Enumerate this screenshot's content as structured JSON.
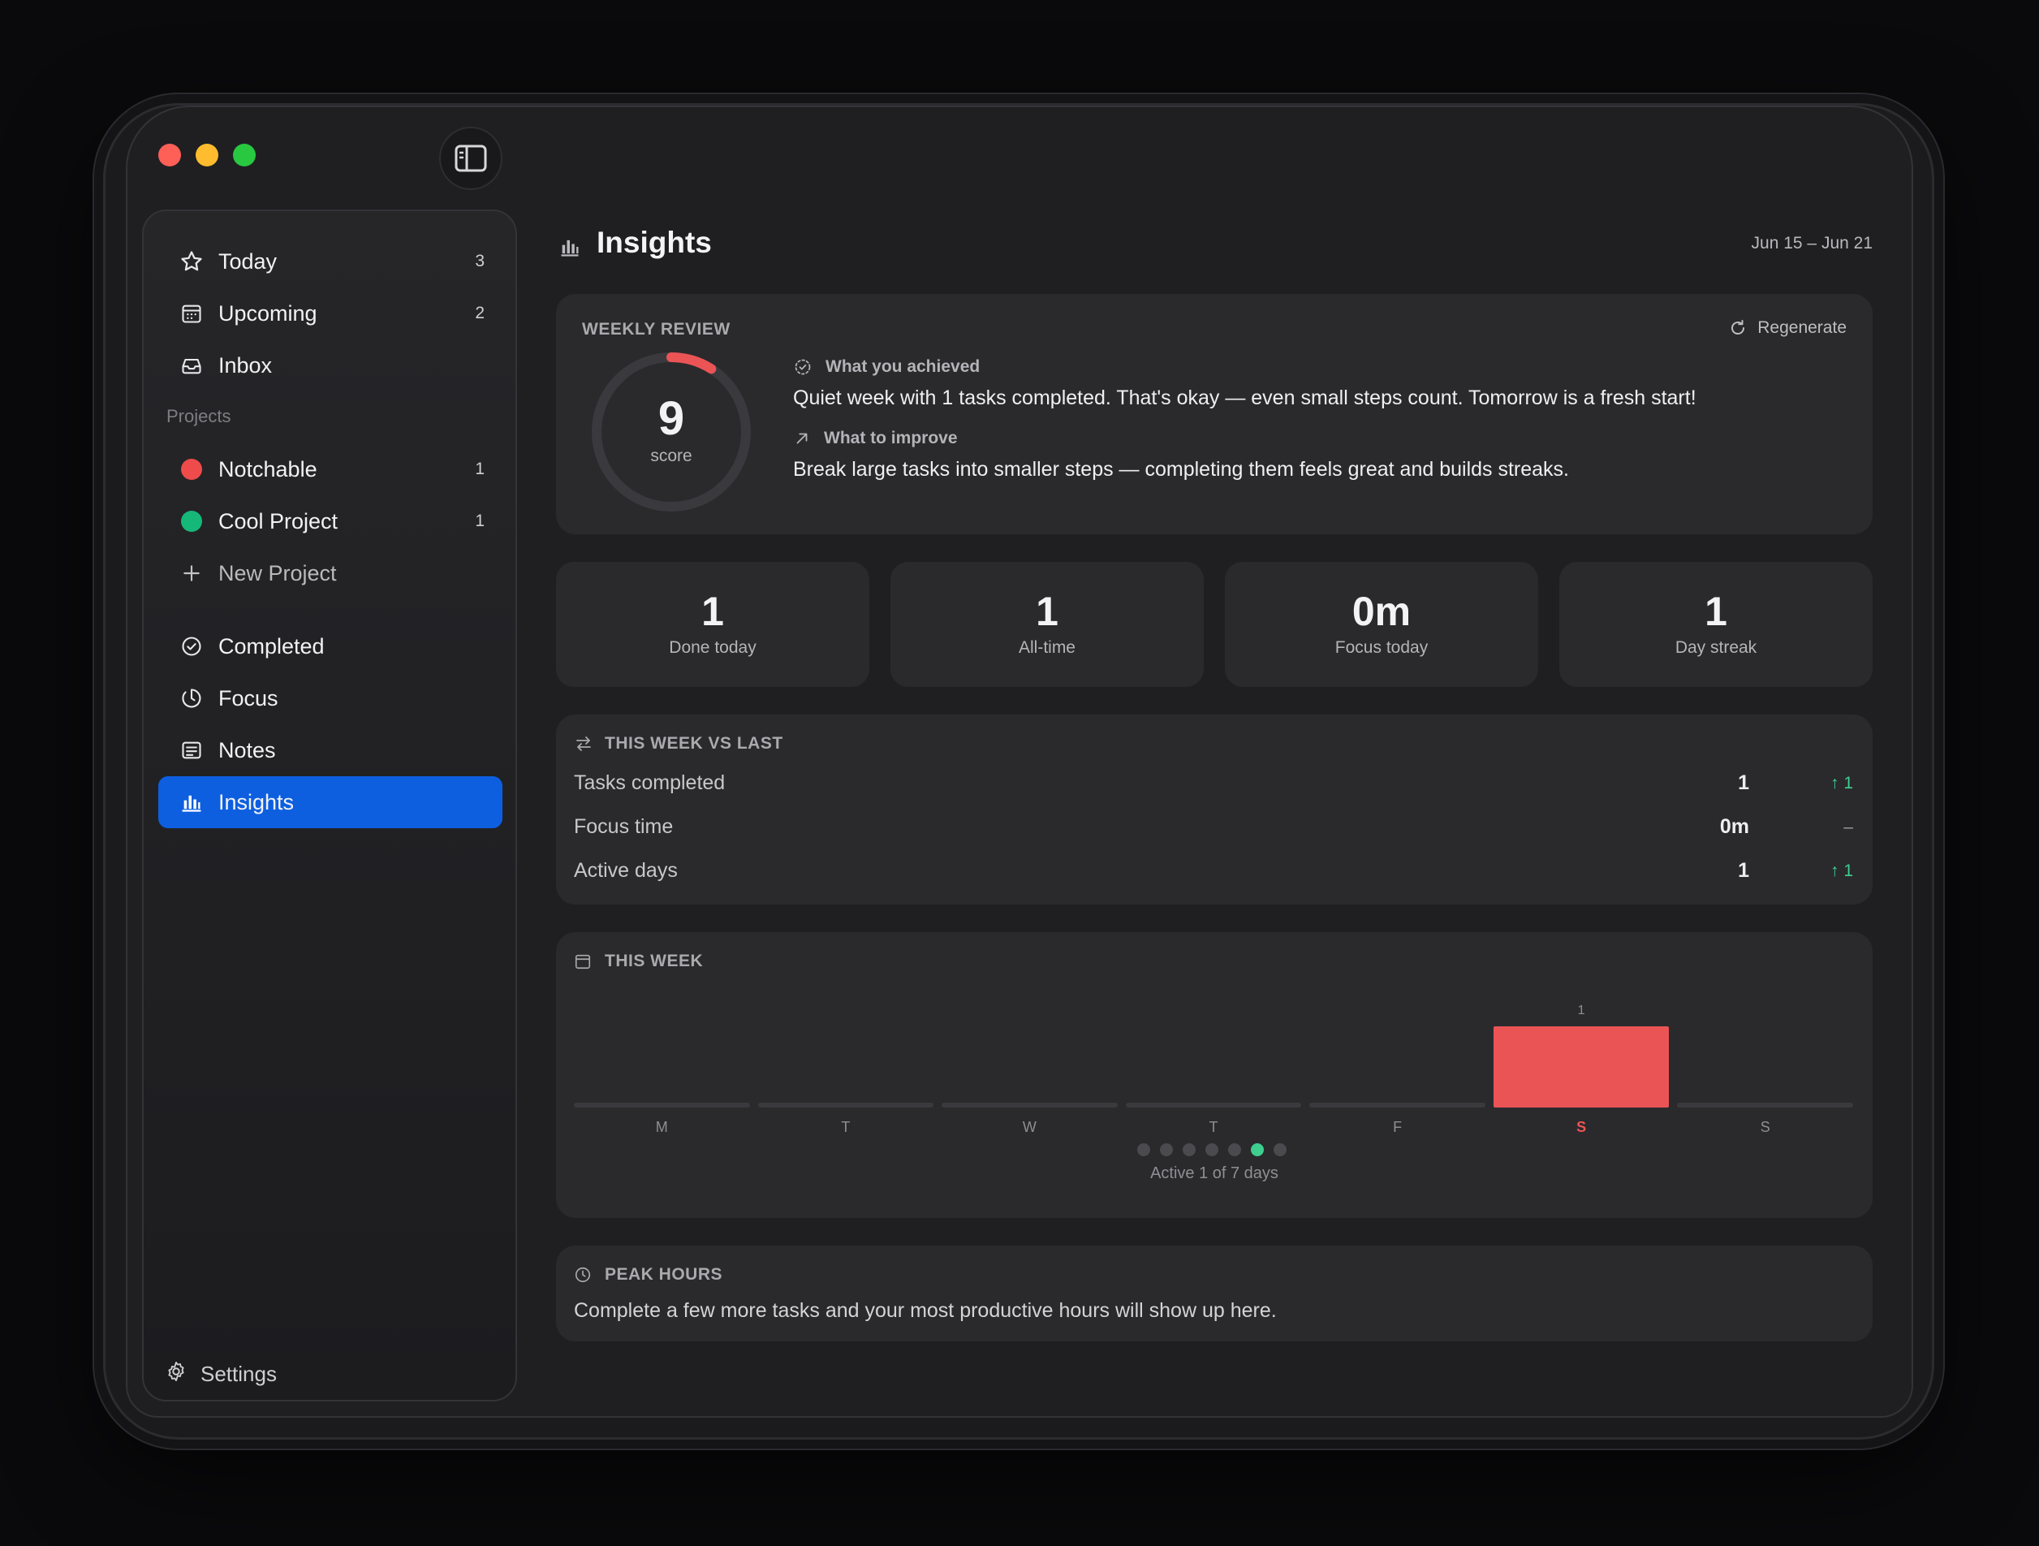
{
  "colors": {
    "accent": "#0d5fe0",
    "bar_highlight": "#ea5455",
    "positive": "#3ecf8e",
    "project_notchable": "#ef4b4b",
    "project_cool": "#16b87a"
  },
  "sidebar": {
    "items": [
      {
        "label": "Today",
        "count": "3",
        "icon": "star-icon"
      },
      {
        "label": "Upcoming",
        "count": "2",
        "icon": "calendar-icon"
      },
      {
        "label": "Inbox",
        "icon": "inbox-icon"
      }
    ],
    "projects_label": "Projects",
    "projects": [
      {
        "label": "Notchable",
        "count": "1"
      },
      {
        "label": "Cool Project",
        "count": "1"
      }
    ],
    "new_project": "New Project",
    "bottom_items": [
      {
        "label": "Completed",
        "icon": "check-circle-icon"
      },
      {
        "label": "Focus",
        "icon": "timer-icon"
      },
      {
        "label": "Notes",
        "icon": "notes-icon"
      },
      {
        "label": "Insights",
        "icon": "chart-bars-icon"
      }
    ],
    "settings": "Settings"
  },
  "header": {
    "title": "Insights",
    "date_range": "Jun 15 – Jun 21"
  },
  "review": {
    "label": "WEEKLY REVIEW",
    "regenerate": "Regenerate",
    "score": "9",
    "score_label": "score",
    "score_fraction": 0.09,
    "achieved_title": "What you achieved",
    "achieved_text": "Quiet week with 1 tasks completed. That's okay — even small steps count. Tomorrow is a fresh start!",
    "improve_title": "What to improve",
    "improve_text": "Break large tasks into smaller steps — completing them feels great and builds streaks."
  },
  "stats": [
    {
      "value": "1",
      "label": "Done today"
    },
    {
      "value": "1",
      "label": "All-time"
    },
    {
      "value": "0m",
      "label": "Focus today"
    },
    {
      "value": "1",
      "label": "Day streak"
    }
  ],
  "compare": {
    "title": "THIS WEEK VS LAST",
    "rows": [
      {
        "label": "Tasks completed",
        "value": "1",
        "delta": "↑ 1"
      },
      {
        "label": "Focus time",
        "value": "0m",
        "delta": "–"
      },
      {
        "label": "Active days",
        "value": "1",
        "delta": "↑ 1"
      }
    ]
  },
  "week": {
    "title": "THIS WEEK",
    "active_text": "Active 1 of 7 days"
  },
  "chart_data": {
    "type": "bar",
    "categories": [
      "M",
      "T",
      "W",
      "T",
      "F",
      "S",
      "S"
    ],
    "values": [
      0,
      0,
      0,
      0,
      0,
      1,
      0
    ],
    "data_labels": [
      "",
      "",
      "",
      "",
      "",
      "1",
      ""
    ],
    "highlight_index": 5,
    "active_days": [
      false,
      false,
      false,
      false,
      false,
      true,
      false
    ]
  },
  "peak": {
    "title": "PEAK HOURS",
    "text": "Complete a few more tasks and your most productive hours will show up here."
  }
}
